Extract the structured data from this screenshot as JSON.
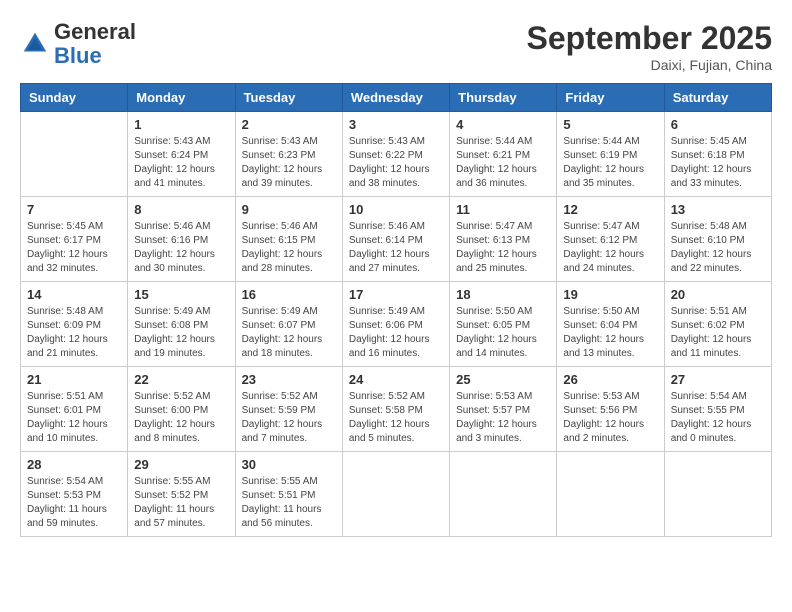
{
  "header": {
    "logo_line1": "General",
    "logo_line2": "Blue",
    "month": "September 2025",
    "location": "Daixi, Fujian, China"
  },
  "weekdays": [
    "Sunday",
    "Monday",
    "Tuesday",
    "Wednesday",
    "Thursday",
    "Friday",
    "Saturday"
  ],
  "weeks": [
    [
      {
        "day": "",
        "info": ""
      },
      {
        "day": "1",
        "info": "Sunrise: 5:43 AM\nSunset: 6:24 PM\nDaylight: 12 hours\nand 41 minutes."
      },
      {
        "day": "2",
        "info": "Sunrise: 5:43 AM\nSunset: 6:23 PM\nDaylight: 12 hours\nand 39 minutes."
      },
      {
        "day": "3",
        "info": "Sunrise: 5:43 AM\nSunset: 6:22 PM\nDaylight: 12 hours\nand 38 minutes."
      },
      {
        "day": "4",
        "info": "Sunrise: 5:44 AM\nSunset: 6:21 PM\nDaylight: 12 hours\nand 36 minutes."
      },
      {
        "day": "5",
        "info": "Sunrise: 5:44 AM\nSunset: 6:19 PM\nDaylight: 12 hours\nand 35 minutes."
      },
      {
        "day": "6",
        "info": "Sunrise: 5:45 AM\nSunset: 6:18 PM\nDaylight: 12 hours\nand 33 minutes."
      }
    ],
    [
      {
        "day": "7",
        "info": "Sunrise: 5:45 AM\nSunset: 6:17 PM\nDaylight: 12 hours\nand 32 minutes."
      },
      {
        "day": "8",
        "info": "Sunrise: 5:46 AM\nSunset: 6:16 PM\nDaylight: 12 hours\nand 30 minutes."
      },
      {
        "day": "9",
        "info": "Sunrise: 5:46 AM\nSunset: 6:15 PM\nDaylight: 12 hours\nand 28 minutes."
      },
      {
        "day": "10",
        "info": "Sunrise: 5:46 AM\nSunset: 6:14 PM\nDaylight: 12 hours\nand 27 minutes."
      },
      {
        "day": "11",
        "info": "Sunrise: 5:47 AM\nSunset: 6:13 PM\nDaylight: 12 hours\nand 25 minutes."
      },
      {
        "day": "12",
        "info": "Sunrise: 5:47 AM\nSunset: 6:12 PM\nDaylight: 12 hours\nand 24 minutes."
      },
      {
        "day": "13",
        "info": "Sunrise: 5:48 AM\nSunset: 6:10 PM\nDaylight: 12 hours\nand 22 minutes."
      }
    ],
    [
      {
        "day": "14",
        "info": "Sunrise: 5:48 AM\nSunset: 6:09 PM\nDaylight: 12 hours\nand 21 minutes."
      },
      {
        "day": "15",
        "info": "Sunrise: 5:49 AM\nSunset: 6:08 PM\nDaylight: 12 hours\nand 19 minutes."
      },
      {
        "day": "16",
        "info": "Sunrise: 5:49 AM\nSunset: 6:07 PM\nDaylight: 12 hours\nand 18 minutes."
      },
      {
        "day": "17",
        "info": "Sunrise: 5:49 AM\nSunset: 6:06 PM\nDaylight: 12 hours\nand 16 minutes."
      },
      {
        "day": "18",
        "info": "Sunrise: 5:50 AM\nSunset: 6:05 PM\nDaylight: 12 hours\nand 14 minutes."
      },
      {
        "day": "19",
        "info": "Sunrise: 5:50 AM\nSunset: 6:04 PM\nDaylight: 12 hours\nand 13 minutes."
      },
      {
        "day": "20",
        "info": "Sunrise: 5:51 AM\nSunset: 6:02 PM\nDaylight: 12 hours\nand 11 minutes."
      }
    ],
    [
      {
        "day": "21",
        "info": "Sunrise: 5:51 AM\nSunset: 6:01 PM\nDaylight: 12 hours\nand 10 minutes."
      },
      {
        "day": "22",
        "info": "Sunrise: 5:52 AM\nSunset: 6:00 PM\nDaylight: 12 hours\nand 8 minutes."
      },
      {
        "day": "23",
        "info": "Sunrise: 5:52 AM\nSunset: 5:59 PM\nDaylight: 12 hours\nand 7 minutes."
      },
      {
        "day": "24",
        "info": "Sunrise: 5:52 AM\nSunset: 5:58 PM\nDaylight: 12 hours\nand 5 minutes."
      },
      {
        "day": "25",
        "info": "Sunrise: 5:53 AM\nSunset: 5:57 PM\nDaylight: 12 hours\nand 3 minutes."
      },
      {
        "day": "26",
        "info": "Sunrise: 5:53 AM\nSunset: 5:56 PM\nDaylight: 12 hours\nand 2 minutes."
      },
      {
        "day": "27",
        "info": "Sunrise: 5:54 AM\nSunset: 5:55 PM\nDaylight: 12 hours\nand 0 minutes."
      }
    ],
    [
      {
        "day": "28",
        "info": "Sunrise: 5:54 AM\nSunset: 5:53 PM\nDaylight: 11 hours\nand 59 minutes."
      },
      {
        "day": "29",
        "info": "Sunrise: 5:55 AM\nSunset: 5:52 PM\nDaylight: 11 hours\nand 57 minutes."
      },
      {
        "day": "30",
        "info": "Sunrise: 5:55 AM\nSunset: 5:51 PM\nDaylight: 11 hours\nand 56 minutes."
      },
      {
        "day": "",
        "info": ""
      },
      {
        "day": "",
        "info": ""
      },
      {
        "day": "",
        "info": ""
      },
      {
        "day": "",
        "info": ""
      }
    ]
  ]
}
